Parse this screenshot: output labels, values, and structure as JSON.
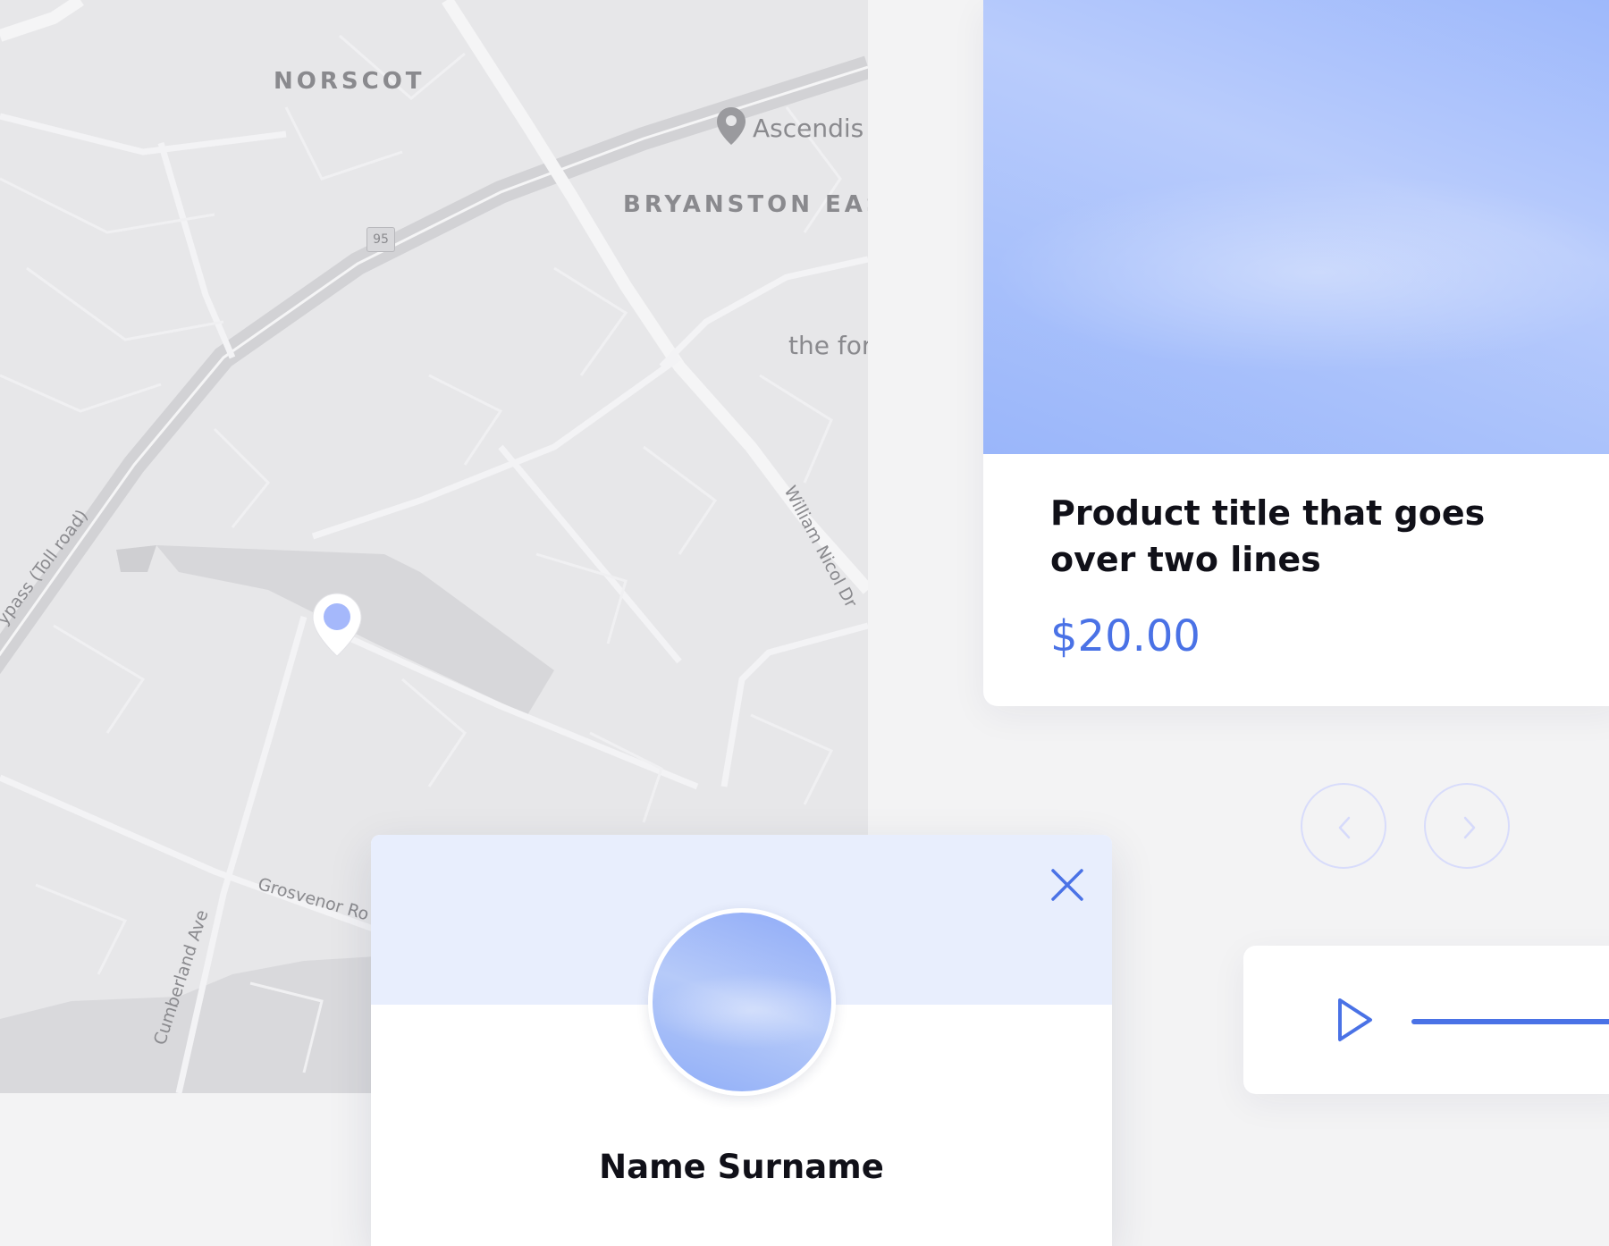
{
  "map": {
    "labels": {
      "norscot": "NORSCOT",
      "ascendis": "Ascendis",
      "bryanston_east": "BRYANSTON EAST",
      "route_number": "95",
      "the_forum": "the for",
      "bypass": "ypass (Toll road)",
      "william_nicol": "William Nicol Dr",
      "grosvenor": "Grosvenor Ro",
      "cumberland": "Cumberland Ave"
    },
    "marker_icon": "location-pin-icon"
  },
  "product": {
    "title": "Product title that goes over two lines",
    "price": "$20.00"
  },
  "carousel": {
    "prev_icon": "chevron-left-icon",
    "next_icon": "chevron-right-icon"
  },
  "audio": {
    "play_icon": "play-icon",
    "progress_percent": 100
  },
  "profile": {
    "name": "Name Surname",
    "close_icon": "close-icon"
  },
  "colors": {
    "accent": "#4a72e6",
    "map_background": "#e7e7e9",
    "page_background": "#f3f3f4",
    "profile_header": "#e8eefd",
    "arrow_border": "#d8dcfb"
  }
}
